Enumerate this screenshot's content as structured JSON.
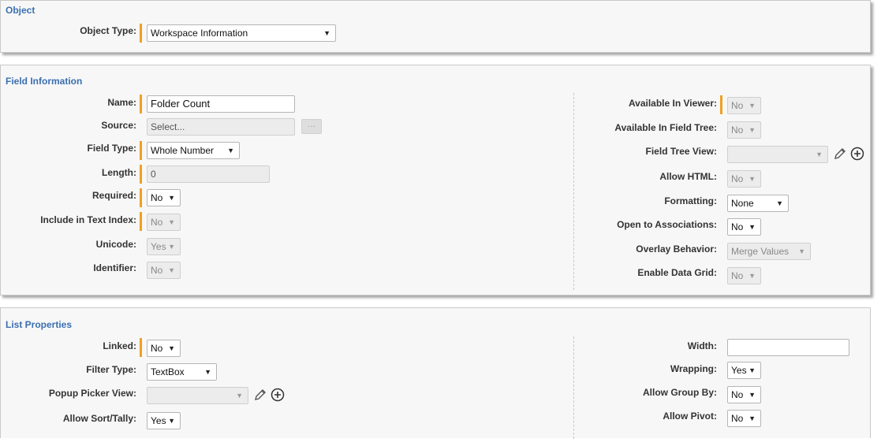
{
  "object": {
    "title": "Object",
    "object_type_label": "Object Type:",
    "object_type_value": "Workspace Information"
  },
  "field_info": {
    "title": "Field Information",
    "left": {
      "name_label": "Name:",
      "name_value": "Folder Count",
      "source_label": "Source:",
      "source_value": "Select...",
      "source_button": "···",
      "field_type_label": "Field Type:",
      "field_type_value": "Whole Number",
      "length_label": "Length:",
      "length_value": "0",
      "required_label": "Required:",
      "required_value": "No",
      "text_index_label": "Include in Text Index:",
      "text_index_value": "No",
      "unicode_label": "Unicode:",
      "unicode_value": "Yes",
      "identifier_label": "Identifier:",
      "identifier_value": "No"
    },
    "right": {
      "avail_viewer_label": "Available In Viewer:",
      "avail_viewer_value": "No",
      "avail_tree_label": "Available In Field Tree:",
      "avail_tree_value": "No",
      "tree_view_label": "Field Tree View:",
      "tree_view_value": "",
      "allow_html_label": "Allow HTML:",
      "allow_html_value": "No",
      "formatting_label": "Formatting:",
      "formatting_value": "None",
      "open_assoc_label": "Open to Associations:",
      "open_assoc_value": "No",
      "overlay_label": "Overlay Behavior:",
      "overlay_value": "Merge Values",
      "data_grid_label": "Enable Data Grid:",
      "data_grid_value": "No"
    }
  },
  "list_props": {
    "title": "List Properties",
    "left": {
      "linked_label": "Linked:",
      "linked_value": "No",
      "filter_type_label": "Filter Type:",
      "filter_type_value": "TextBox",
      "popup_label": "Popup Picker View:",
      "popup_value": "",
      "sort_label": "Allow Sort/Tally:",
      "sort_value": "Yes"
    },
    "right": {
      "width_label": "Width:",
      "width_value": "",
      "wrapping_label": "Wrapping:",
      "wrapping_value": "Yes",
      "group_label": "Allow Group By:",
      "group_value": "No",
      "pivot_label": "Allow Pivot:",
      "pivot_value": "No"
    }
  },
  "colors": {
    "accent": "#3a6fb0",
    "required_bar": "#f0a020"
  },
  "icons": {
    "edit": "pencil-icon",
    "add": "plus-circle-icon",
    "dropdown": "chevron-down-icon"
  }
}
